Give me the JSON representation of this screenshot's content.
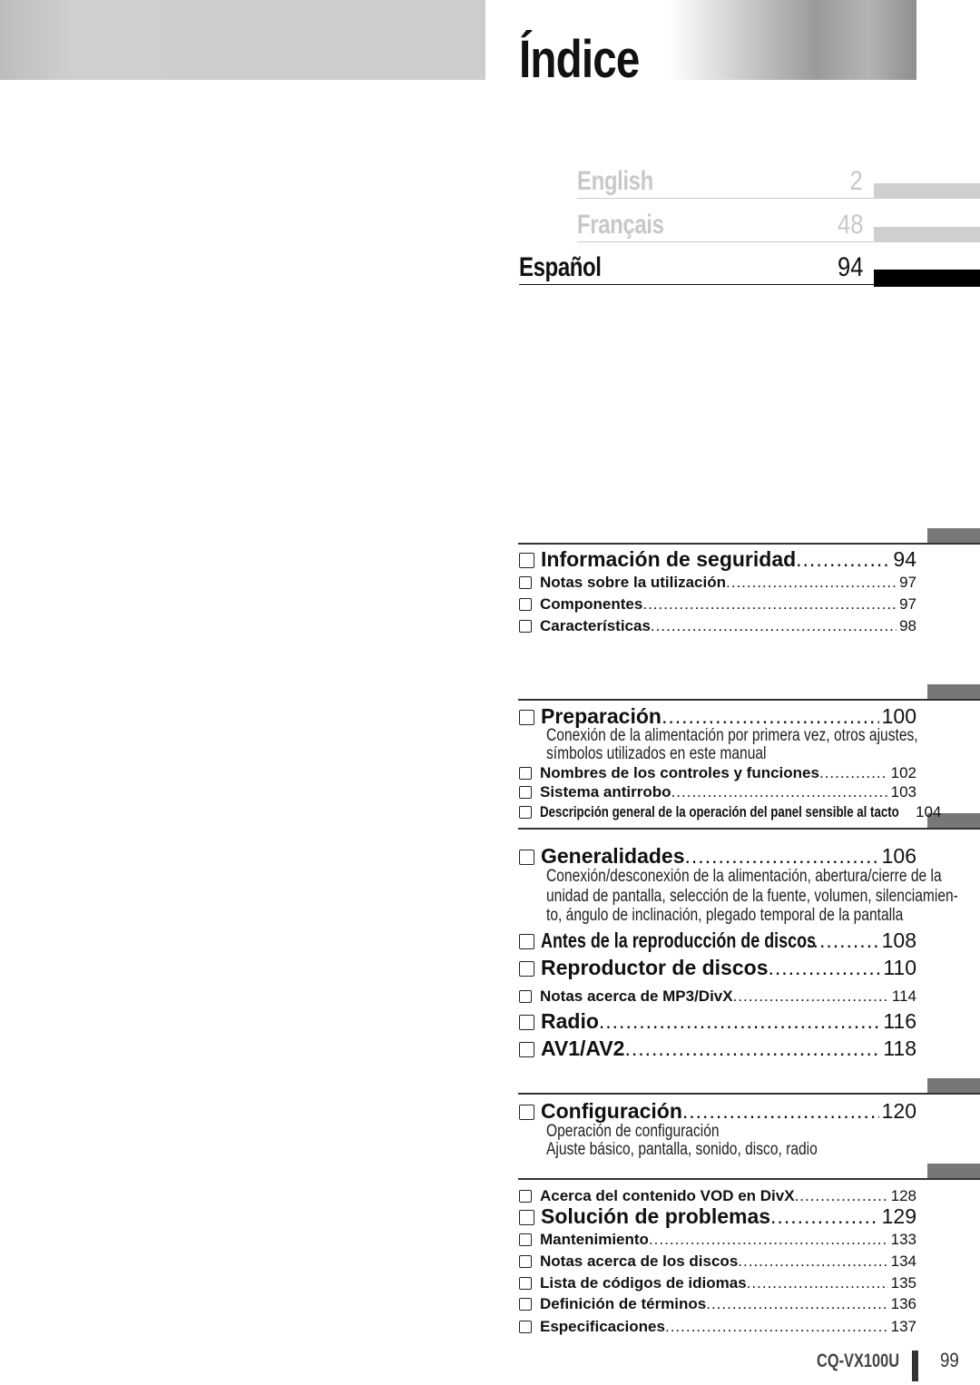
{
  "header": {
    "title": "Índice"
  },
  "languages": [
    {
      "name": "English",
      "page": "2",
      "state": "inactive"
    },
    {
      "name": "Français",
      "page": "48",
      "state": "inactive"
    },
    {
      "name": "Español",
      "page": "94",
      "state": "active"
    }
  ],
  "entries": [
    {
      "label": "Información de seguridad",
      "page": "94",
      "size": "big"
    },
    {
      "label": "Notas sobre la utilización",
      "page": "97",
      "size": "small"
    },
    {
      "label": "Componentes",
      "page": "97",
      "size": "small"
    },
    {
      "label": "Características",
      "page": "98",
      "size": "small"
    },
    {
      "label": "Preparación",
      "page": "100",
      "size": "big",
      "description": [
        "Conexión de la alimentación por primera vez, otros ajustes,",
        "símbolos utilizados en este manual"
      ]
    },
    {
      "label": "Nombres de los controles y funciones",
      "page": "102",
      "size": "small"
    },
    {
      "label": "Sistema antirrobo",
      "page": "103",
      "size": "small"
    },
    {
      "label": "Descripción general de la operación del panel sensible al tacto",
      "page": "104",
      "size": "small",
      "condensed": true
    },
    {
      "label": "Generalidades",
      "page": "106",
      "size": "big",
      "description": [
        "Conexión/desconexión de la alimentación, abertura/cierre de la",
        "unidad de pantalla, selección de la fuente, volumen, silenciamien-",
        "to, ángulo de inclinación, plegado temporal de la pantalla"
      ]
    },
    {
      "label": "Antes de la reproducción de discos",
      "page": "108",
      "size": "big",
      "condensed": true
    },
    {
      "label": "Reproductor de discos",
      "page": "110",
      "size": "big"
    },
    {
      "label": "Notas acerca de MP3/DivX",
      "page": "114",
      "size": "small"
    },
    {
      "label": "Radio",
      "page": "116",
      "size": "big"
    },
    {
      "label": "AV1/AV2",
      "page": "118",
      "size": "big"
    },
    {
      "label": "Configuración",
      "page": "120",
      "size": "big",
      "description": [
        "Operación de configuración",
        "Ajuste básico, pantalla, sonido, disco, radio"
      ]
    },
    {
      "label": "Acerca del contenido VOD en DivX",
      "page": "128",
      "size": "small"
    },
    {
      "label": "Solución de problemas",
      "page": "129",
      "size": "big"
    },
    {
      "label": "Mantenimiento",
      "page": "133",
      "size": "small"
    },
    {
      "label": "Notas acerca de los discos",
      "page": "134",
      "size": "small"
    },
    {
      "label": "Lista de códigos de idiomas",
      "page": "135",
      "size": "small"
    },
    {
      "label": "Definición de términos",
      "page": "136",
      "size": "small"
    },
    {
      "label": "Especificaciones",
      "page": "137",
      "size": "small"
    }
  ],
  "footer": {
    "model": "CQ-VX100U",
    "page_number": "99"
  }
}
